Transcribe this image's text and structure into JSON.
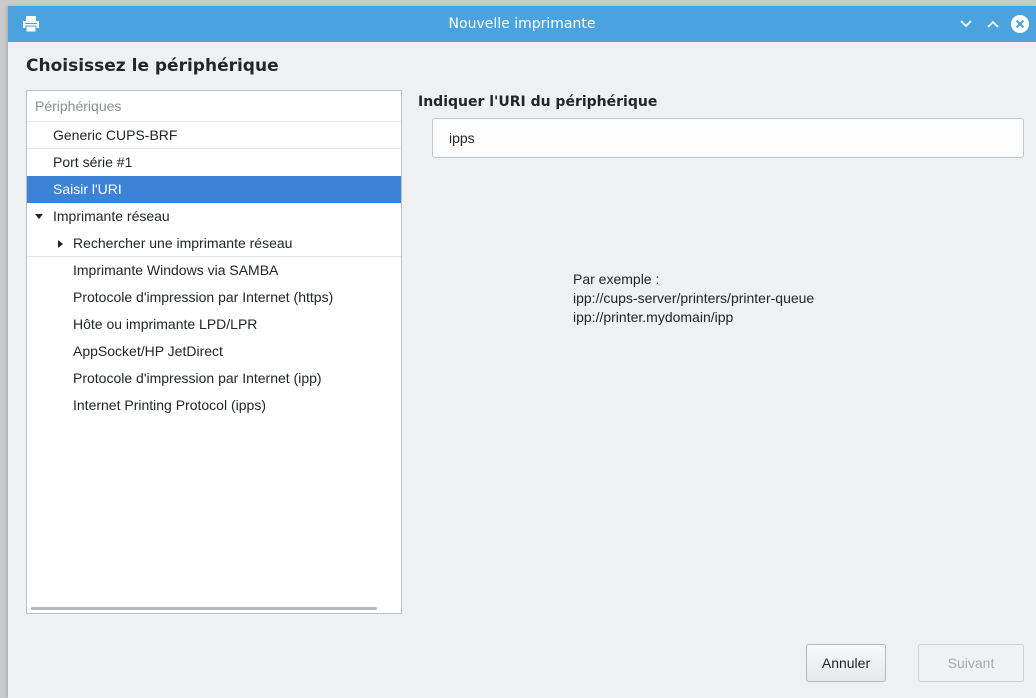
{
  "window": {
    "title": "Nouvelle imprimante",
    "icons": [
      "printer-icon",
      "minimize-icon",
      "maximize-icon",
      "close-icon"
    ]
  },
  "heading": "Choisissez le périphérique",
  "devices": {
    "header": "Périphériques",
    "items": [
      {
        "label": "Generic CUPS-BRF"
      },
      {
        "label": "Port série #1"
      },
      {
        "label": "Saisir l'URI",
        "selected": true
      },
      {
        "label": "Imprimante réseau",
        "expanded": true
      },
      {
        "label": "Rechercher une imprimante réseau",
        "expanded": false
      },
      {
        "label": "Imprimante Windows via SAMBA"
      },
      {
        "label": "Protocole d'impression par Internet (https)"
      },
      {
        "label": "Hôte ou imprimante LPD/LPR"
      },
      {
        "label": "AppSocket/HP JetDirect"
      },
      {
        "label": "Protocole d'impression par Internet (ipp)"
      },
      {
        "label": "Internet Printing Protocol (ipps)"
      }
    ]
  },
  "uri": {
    "label": "Indiquer l'URI du périphérique",
    "value": "ipps"
  },
  "example": {
    "title": "Par exemple :",
    "line1": "ipp://cups-server/printers/printer-queue",
    "line2": "ipp://printer.mydomain/ipp"
  },
  "buttons": {
    "cancel": "Annuler",
    "next": "Suivant"
  },
  "colors": {
    "titlebar": "#4aa3df",
    "selection": "#3b83d6"
  }
}
